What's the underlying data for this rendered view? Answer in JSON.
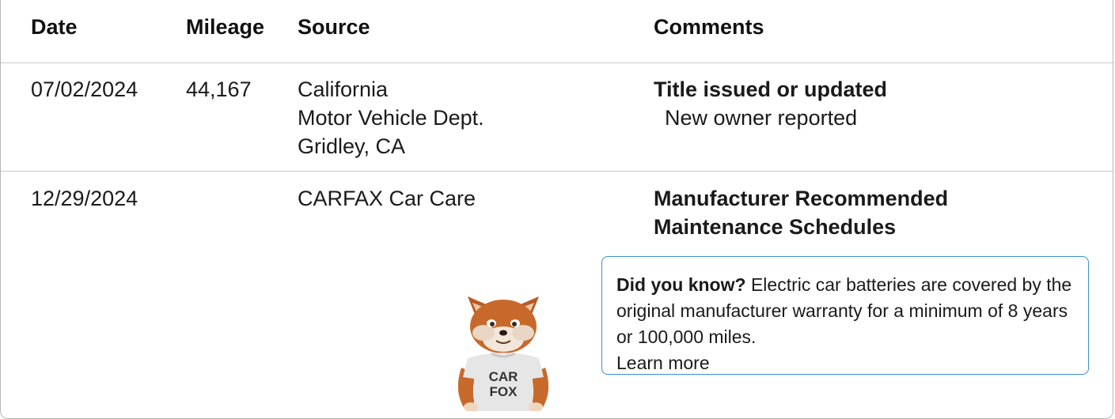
{
  "table": {
    "headers": {
      "date": "Date",
      "mileage": "Mileage",
      "source": "Source",
      "comments": "Comments"
    },
    "rows": [
      {
        "date": "07/02/2024",
        "mileage": "44,167",
        "source": [
          "California",
          "Motor Vehicle Dept.",
          "Gridley, CA"
        ],
        "comment_title": "Title issued or updated",
        "comment_detail": "New owner reported"
      },
      {
        "date": "12/29/2024",
        "mileage": "",
        "source": [
          "CARFAX Car Care"
        ],
        "comment_title_lines": [
          "Manufacturer Recommended",
          "Maintenance Schedules"
        ]
      }
    ]
  },
  "did_you_know": {
    "lead": "Did you know?",
    "body": "Electric car batteries are covered by the original manufacturer warranty for a minimum of 8 years or 100,000 miles.",
    "link": "Learn more"
  },
  "mascot": {
    "shirt_line1": "CAR",
    "shirt_line2": "FOX"
  },
  "colors": {
    "border": "#b5b5b5",
    "callout_border": "#3a8fd6",
    "fox_orange": "#c8692c"
  }
}
